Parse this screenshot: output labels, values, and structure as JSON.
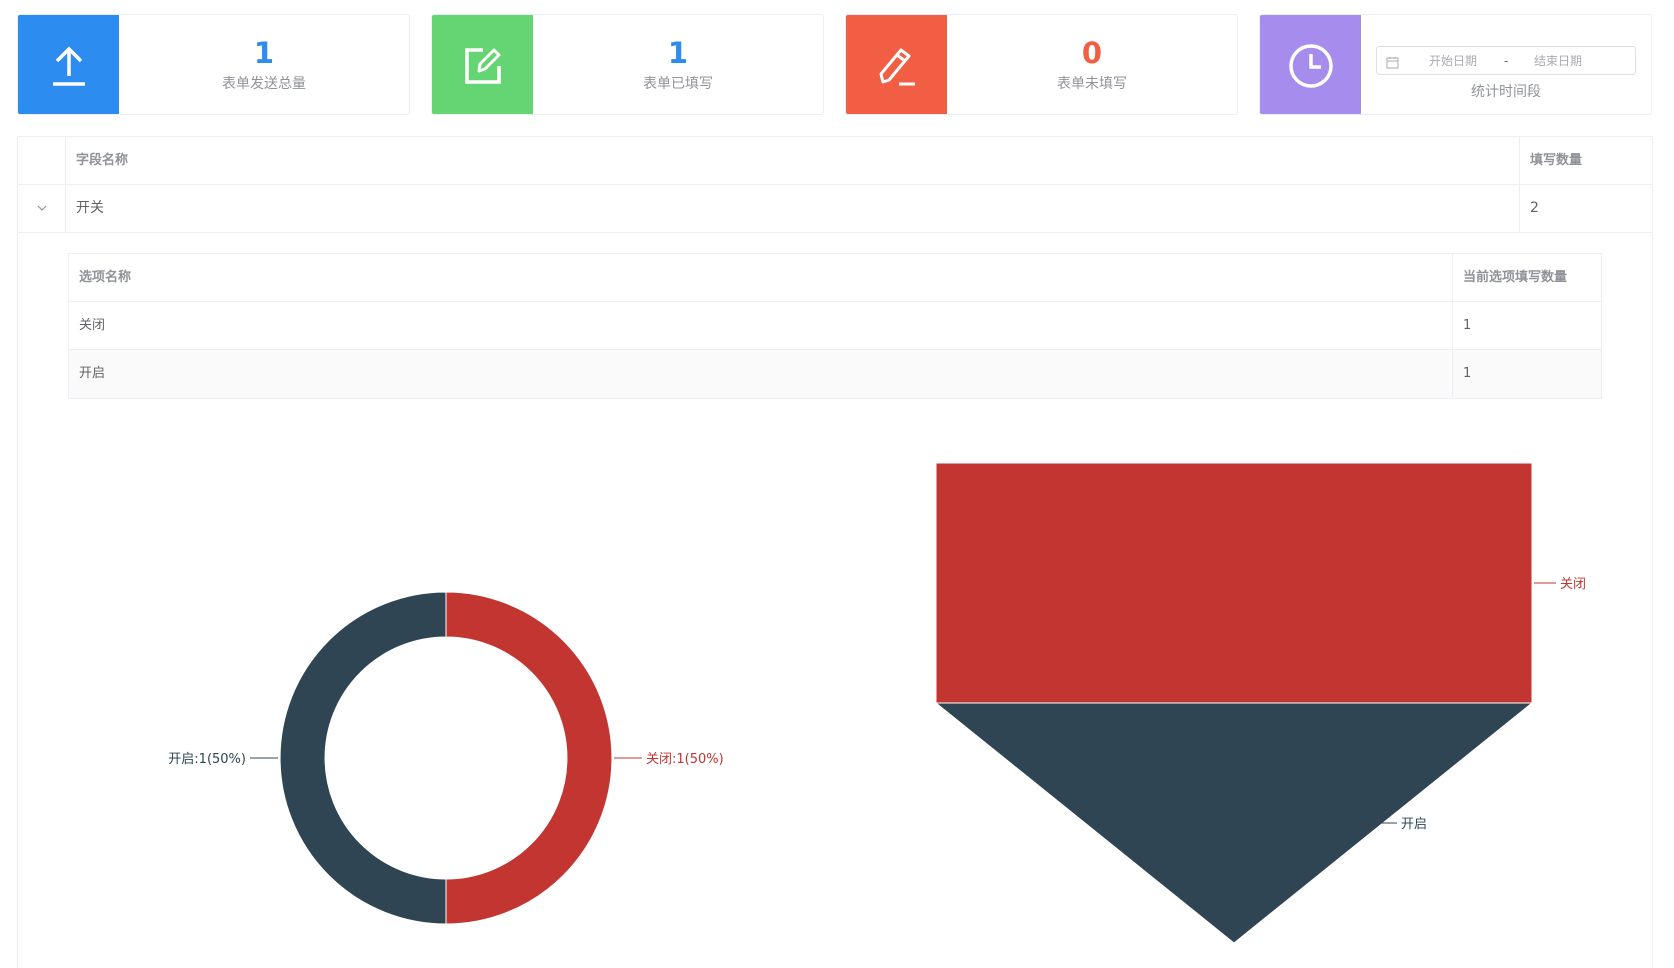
{
  "cards": [
    {
      "value": "1",
      "label": "表单发送总量",
      "color": "#2d8cf0",
      "value_color": "#2d8cf0",
      "icon": "upload-icon"
    },
    {
      "value": "1",
      "label": "表单已填写",
      "color": "#64d572",
      "value_color": "#2d8cf0",
      "icon": "edit-icon"
    },
    {
      "value": "0",
      "label": "表单未填写",
      "color": "#f25e43",
      "value_color": "#f25e43",
      "icon": "pencil-icon"
    },
    {
      "label": "统计时间段",
      "color": "#a58ced",
      "icon": "clock-icon"
    }
  ],
  "date_range": {
    "start_placeholder": "开始日期",
    "separator": "-",
    "end_placeholder": "结束日期"
  },
  "table": {
    "headers": {
      "name": "字段名称",
      "count": "填写数量"
    },
    "rows": [
      {
        "name": "开关",
        "count": "2"
      }
    ]
  },
  "sub_table": {
    "headers": {
      "name": "选项名称",
      "count": "当前选项填写数量"
    },
    "rows": [
      {
        "name": "关闭",
        "count": "1"
      },
      {
        "name": "开启",
        "count": "1"
      }
    ]
  },
  "colors": {
    "red": "#c23531",
    "dark": "#2f4554"
  },
  "chart_data": [
    {
      "type": "pie",
      "donut": true,
      "slices": [
        {
          "name": "关闭",
          "value": 1,
          "percent": 50,
          "label": "关闭:1(50%)",
          "color": "#c23531"
        },
        {
          "name": "开启",
          "value": 1,
          "percent": 50,
          "label": "开启:1(50%)",
          "color": "#2f4554"
        }
      ]
    },
    {
      "type": "funnel",
      "stages": [
        {
          "name": "关闭",
          "value": 1,
          "color": "#c23531"
        },
        {
          "name": "开启",
          "value": 1,
          "color": "#2f4554"
        }
      ]
    }
  ]
}
